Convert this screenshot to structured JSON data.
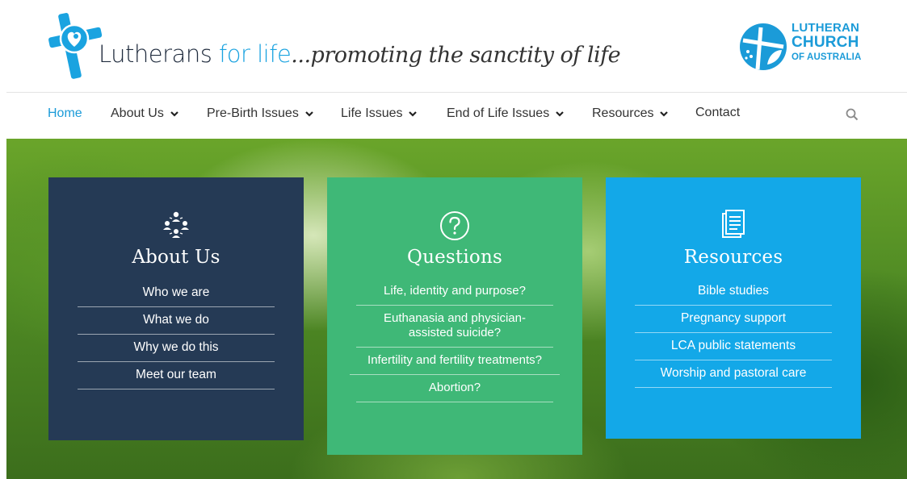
{
  "brand": {
    "name_part1": "Lutherans",
    "name_part2": " for life",
    "tagline": "...promoting the sanctity of life",
    "partner_line1": "LUTHERAN",
    "partner_line2": "CHURCH",
    "partner_line3": "OF AUSTRALIA"
  },
  "nav": {
    "items": [
      {
        "label": "Home"
      },
      {
        "label": "About Us"
      },
      {
        "label": "Pre-Birth Issues"
      },
      {
        "label": "Life Issues"
      },
      {
        "label": "End of Life Issues"
      },
      {
        "label": "Resources"
      },
      {
        "label": "Contact"
      }
    ],
    "search_icon": "search-icon"
  },
  "cards": [
    {
      "title": "About Us",
      "icon": "team-icon",
      "color": "#253a55",
      "links": [
        "Who we are",
        "What we do",
        "Why we do this",
        "Meet our team"
      ]
    },
    {
      "title": "Questions",
      "icon": "question-circle-icon",
      "color": "#3fb877",
      "links": [
        "Life, identity and purpose?",
        "Euthanasia and physician-assisted suicide?",
        "Infertility and fertility treatments?",
        "Abortion?"
      ]
    },
    {
      "title": "Resources",
      "icon": "document-icon",
      "color": "#13a8e8",
      "links": [
        "Bible studies",
        "Pregnancy support",
        "LCA public statements",
        "Worship and pastoral care"
      ]
    }
  ],
  "colors": {
    "accent": "#1b9bd8",
    "nav_text": "#333333"
  }
}
